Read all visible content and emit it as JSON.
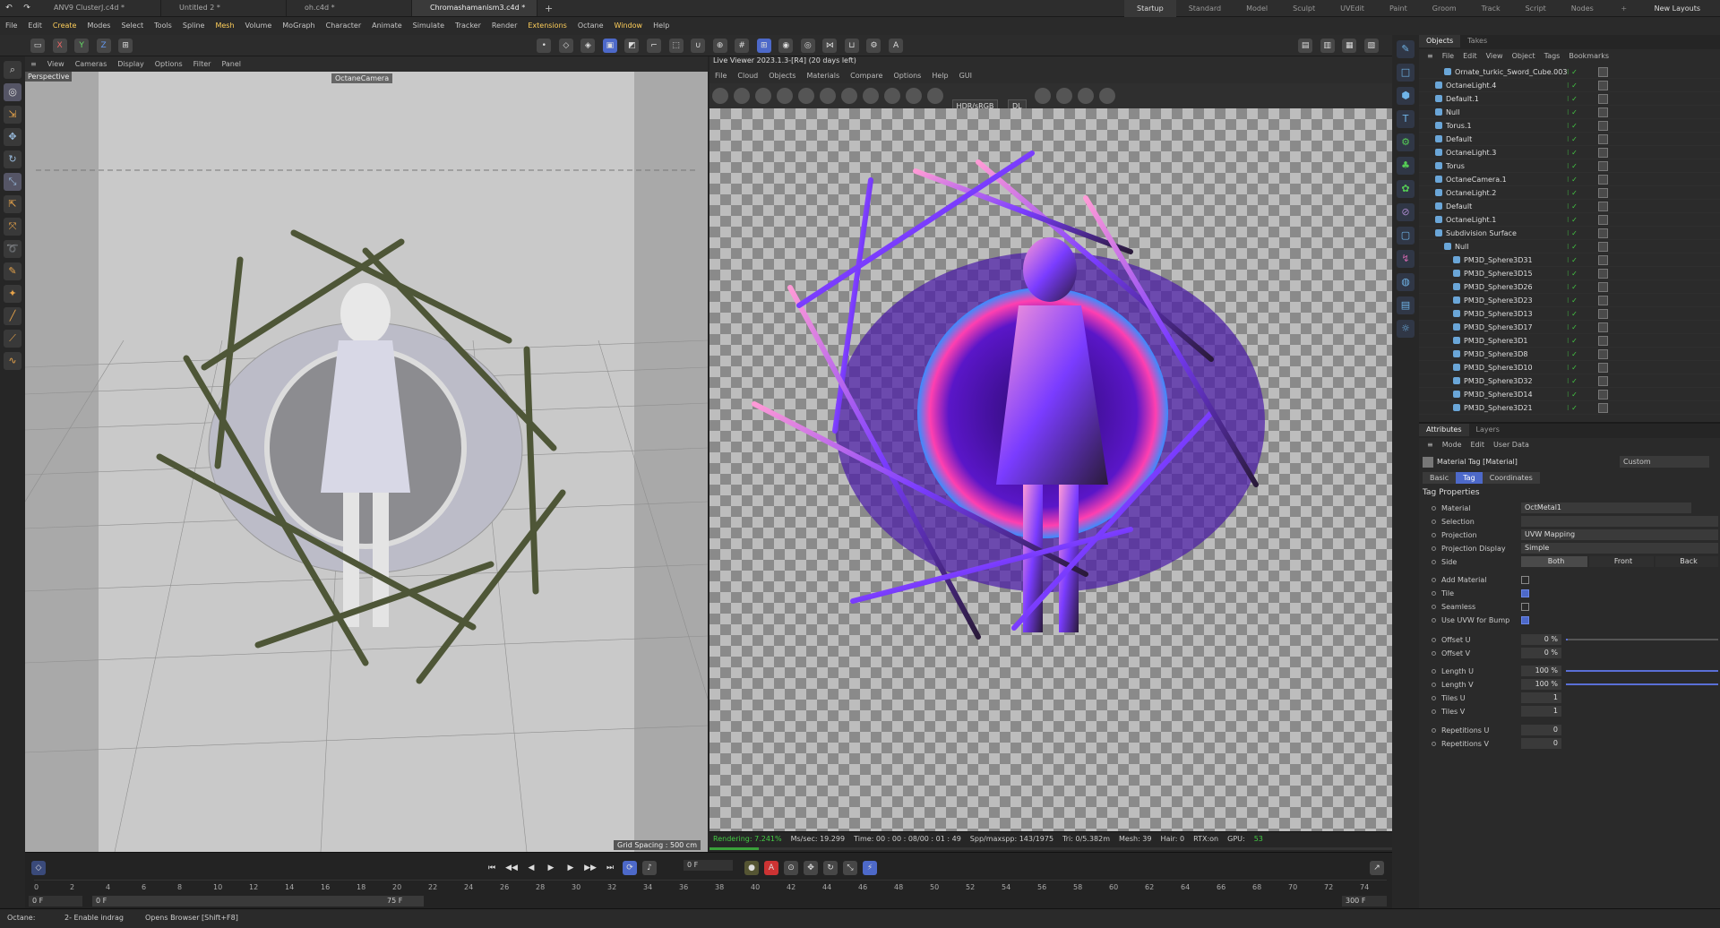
{
  "tabs": {
    "docs": [
      "ANV9 ClusterJ.c4d *",
      "Untitled 2 *",
      "oh.c4d *",
      "Chromashamanism3.c4d *"
    ],
    "active": 3,
    "layouts": [
      "Startup",
      "Standard",
      "Model",
      "Sculpt",
      "UVEdit",
      "Paint",
      "Groom",
      "Track",
      "Script",
      "Nodes"
    ],
    "new_layouts": "New Layouts"
  },
  "menu": [
    "File",
    "Edit",
    "Create",
    "Modes",
    "Select",
    "Tools",
    "Spline",
    "Mesh",
    "Volume",
    "MoGraph",
    "Character",
    "Animate",
    "Simulate",
    "Tracker",
    "Render",
    "Extensions",
    "Octane",
    "Window",
    "Help"
  ],
  "toolbar_axes": [
    "X",
    "Y",
    "Z"
  ],
  "viewport": {
    "menu": [
      "View",
      "Cameras",
      "Display",
      "Options",
      "Filter",
      "Panel"
    ],
    "label": "Perspective",
    "camera": "OctaneCamera",
    "grid": "Grid Spacing : 500 cm"
  },
  "liveviewer": {
    "title": "Live Viewer 2023.1.3-[R4] (20 days left)",
    "menu": [
      "File",
      "Cloud",
      "Objects",
      "Materials",
      "Compare",
      "Options",
      "Help",
      "GUI"
    ],
    "colorspace": "HDR/sRGB",
    "mode": "DL",
    "status": {
      "rendering": "Rendering: 7.241%",
      "ms": "Ms/sec: 19.299",
      "time": "Time: 00 : 00 : 08/00 : 01 : 49",
      "spp": "Spp/maxspp: 143/1975",
      "tri": "Tri: 0/5.382m",
      "mesh": "Mesh: 39",
      "hair": "Hair: 0",
      "rtx": "RTX:on",
      "gpu": "GPU:",
      "gpu_val": "53"
    },
    "progress": 0.07241
  },
  "timeline": {
    "ticks": [
      "0",
      "2",
      "4",
      "6",
      "8",
      "10",
      "12",
      "14",
      "16",
      "18",
      "20",
      "22",
      "24",
      "26",
      "28",
      "30",
      "32",
      "34",
      "36",
      "38",
      "40",
      "42",
      "44",
      "46",
      "48",
      "50",
      "52",
      "54",
      "56",
      "58",
      "60",
      "62",
      "64",
      "66",
      "68",
      "70",
      "72",
      "74"
    ],
    "current_frame": "0 F",
    "start": "0 F",
    "start2": "0 F",
    "end": "75 F",
    "max": "300 F"
  },
  "statusline": {
    "octane": "Octane:",
    "msg": "2- Enable indrag",
    "hint": "Opens Browser [Shift+F8]"
  },
  "objects": {
    "tabs": [
      "Objects",
      "Takes"
    ],
    "menu": [
      "File",
      "Edit",
      "View",
      "Object",
      "Tags",
      "Bookmarks"
    ],
    "items": [
      {
        "name": "Ornate_turkic_Sword_Cube.003",
        "indent": 2
      },
      {
        "name": "OctaneLight.4",
        "indent": 1
      },
      {
        "name": "Default.1",
        "indent": 1
      },
      {
        "name": "Null",
        "indent": 1
      },
      {
        "name": "Torus.1",
        "indent": 1
      },
      {
        "name": "Default",
        "indent": 1
      },
      {
        "name": "OctaneLight.3",
        "indent": 1
      },
      {
        "name": "Torus",
        "indent": 1
      },
      {
        "name": "OctaneCamera.1",
        "indent": 1
      },
      {
        "name": "OctaneLight.2",
        "indent": 1
      },
      {
        "name": "Default",
        "indent": 1
      },
      {
        "name": "OctaneLight.1",
        "indent": 1
      },
      {
        "name": "Subdivision Surface",
        "indent": 1
      },
      {
        "name": "Null",
        "indent": 2
      },
      {
        "name": "PM3D_Sphere3D31",
        "indent": 3
      },
      {
        "name": "PM3D_Sphere3D15",
        "indent": 3
      },
      {
        "name": "PM3D_Sphere3D26",
        "indent": 3
      },
      {
        "name": "PM3D_Sphere3D23",
        "indent": 3
      },
      {
        "name": "PM3D_Sphere3D13",
        "indent": 3
      },
      {
        "name": "PM3D_Sphere3D17",
        "indent": 3
      },
      {
        "name": "PM3D_Sphere3D1",
        "indent": 3
      },
      {
        "name": "PM3D_Sphere3D8",
        "indent": 3
      },
      {
        "name": "PM3D_Sphere3D10",
        "indent": 3
      },
      {
        "name": "PM3D_Sphere3D32",
        "indent": 3
      },
      {
        "name": "PM3D_Sphere3D14",
        "indent": 3
      },
      {
        "name": "PM3D_Sphere3D21",
        "indent": 3
      }
    ]
  },
  "attributes": {
    "tabs": [
      "Attributes",
      "Layers"
    ],
    "menu": [
      "Mode",
      "Edit",
      "User Data"
    ],
    "title": "Material Tag [Material]",
    "preset": "Custom",
    "subtabs": [
      "Basic",
      "Tag",
      "Coordinates"
    ],
    "active_subtab": 1,
    "section": "Tag Properties",
    "material_label": "Material",
    "material": "OctMetal1",
    "selection_label": "Selection",
    "projection_label": "Projection",
    "projection": "UVW Mapping",
    "projdisp_label": "Projection Display",
    "projdisp": "Simple",
    "side_label": "Side",
    "side_opts": [
      "Both",
      "Front",
      "Back"
    ],
    "add_material": "Add Material",
    "tile": "Tile",
    "seamless": "Seamless",
    "use_uvw": "Use UVW for Bump",
    "offset_u": "Offset U",
    "offset_u_val": "0 %",
    "offset_v": "Offset V",
    "offset_v_val": "0 %",
    "length_u": "Length U",
    "length_u_val": "100 %",
    "length_v": "Length V",
    "length_v_val": "100 %",
    "tiles_u": "Tiles U",
    "tiles_u_val": "1",
    "tiles_v": "Tiles V",
    "tiles_v_val": "1",
    "rep_u": "Repetitions U",
    "rep_u_val": "0",
    "rep_v": "Repetitions V",
    "rep_v_val": "0"
  },
  "colors": {
    "accent": "#4d69c9",
    "menu_highlight": "#ffcf5a",
    "progress": "#3aa03a"
  }
}
